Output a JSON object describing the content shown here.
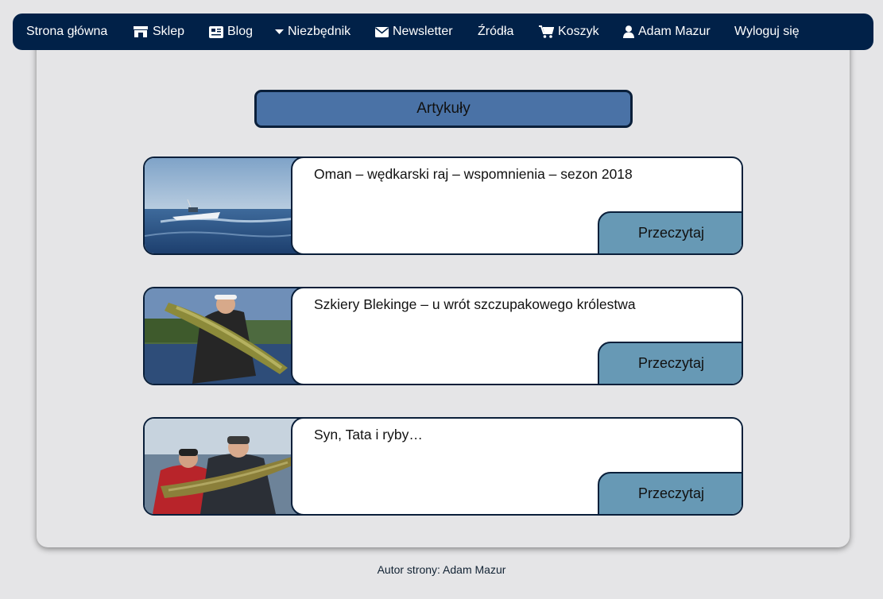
{
  "nav": {
    "home": "Strona główna",
    "shop": "Sklep",
    "blog": "Blog",
    "essentials": "Niezbędnik",
    "newsletter": "Newsletter",
    "sources": "Źródła",
    "cart": "Koszyk",
    "user": "Adam Mazur",
    "logout": "Wyloguj się"
  },
  "heading": "Artykuły",
  "articles": [
    {
      "title": "Oman – wędkarski raj – wspomnienia – sezon 2018",
      "button": "Przeczytaj"
    },
    {
      "title": "Szkiery Blekinge – u wrót szczupakowego królestwa",
      "button": "Przeczytaj"
    },
    {
      "title": "Syn, Tata i ryby…",
      "button": "Przeczytaj"
    }
  ],
  "footer": "Autor strony: Adam Mazur",
  "colors": {
    "navbar": "#012148",
    "heading": "#4a72a6",
    "button": "#6799b5",
    "background": "#e5e5e7"
  }
}
